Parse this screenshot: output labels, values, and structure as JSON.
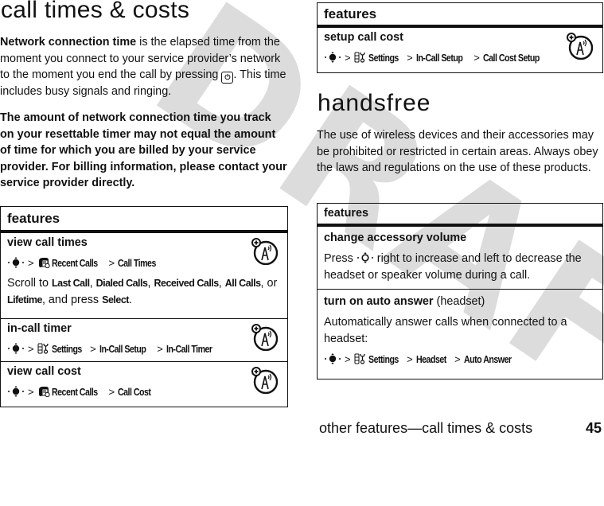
{
  "watermark": "DRAFT",
  "left": {
    "title": "call times & costs",
    "para1": {
      "bold_lead": "Network connection time",
      "text_a": " is the elapsed time from the moment you connect to your service provider’s network to the moment you end the call by pressing ",
      "end_key_icon": "end-key-icon",
      "text_b": ". This time includes busy signals and ringing."
    },
    "para2": "The amount of network connection time you track on your resettable timer may not equal the amount of time for which you are billed by your service provider. For billing information, please contact your service provider directly.",
    "table": {
      "header": "features",
      "rows": [
        {
          "title": "view call times",
          "path": [
            "Recent Calls",
            "Call Times"
          ],
          "menu_icon": "recent-calls-icon",
          "desc_parts": [
            "Scroll to ",
            "Last Call",
            ", ",
            "Dialed Calls",
            ", ",
            "Received Calls",
            ", ",
            "All Calls",
            ", or ",
            "Lifetime",
            ", and press ",
            "Select",
            "."
          ]
        },
        {
          "title": "in-call timer",
          "path": [
            "Settings",
            "In-Call Setup",
            "In-Call Timer"
          ],
          "menu_icon": "settings-icon"
        },
        {
          "title": "view call cost",
          "path": [
            "Recent Calls",
            "Call Cost"
          ],
          "menu_icon": "recent-calls-icon"
        }
      ]
    }
  },
  "right": {
    "top_table": {
      "header": "features",
      "rows": [
        {
          "title": "setup call cost",
          "path": [
            "Settings",
            "In-Call Setup",
            "Call Cost Setup"
          ],
          "menu_icon": "settings-icon"
        }
      ]
    },
    "title": "handsfree",
    "para": "The use of wireless devices and their accessories may be prohibited or restricted in certain areas. Always obey the laws and regulations on the use of these products.",
    "table": {
      "header": "features",
      "rows": [
        {
          "title": "change accessory volume",
          "desc_a": "Press ",
          "desc_b": " right to increase and left to decrease the headset or speaker volume during a call."
        },
        {
          "title": "turn on auto answer",
          "title_suffix": " (headset)",
          "desc": "Automatically answer calls when connected to a headset:",
          "path": [
            "Settings",
            "Headset",
            "Auto Answer"
          ],
          "menu_icon": "settings-icon"
        }
      ]
    }
  },
  "footer": {
    "text": "other features—call times & costs",
    "page_number": "45"
  },
  "symbols": {
    "separator": ">"
  }
}
